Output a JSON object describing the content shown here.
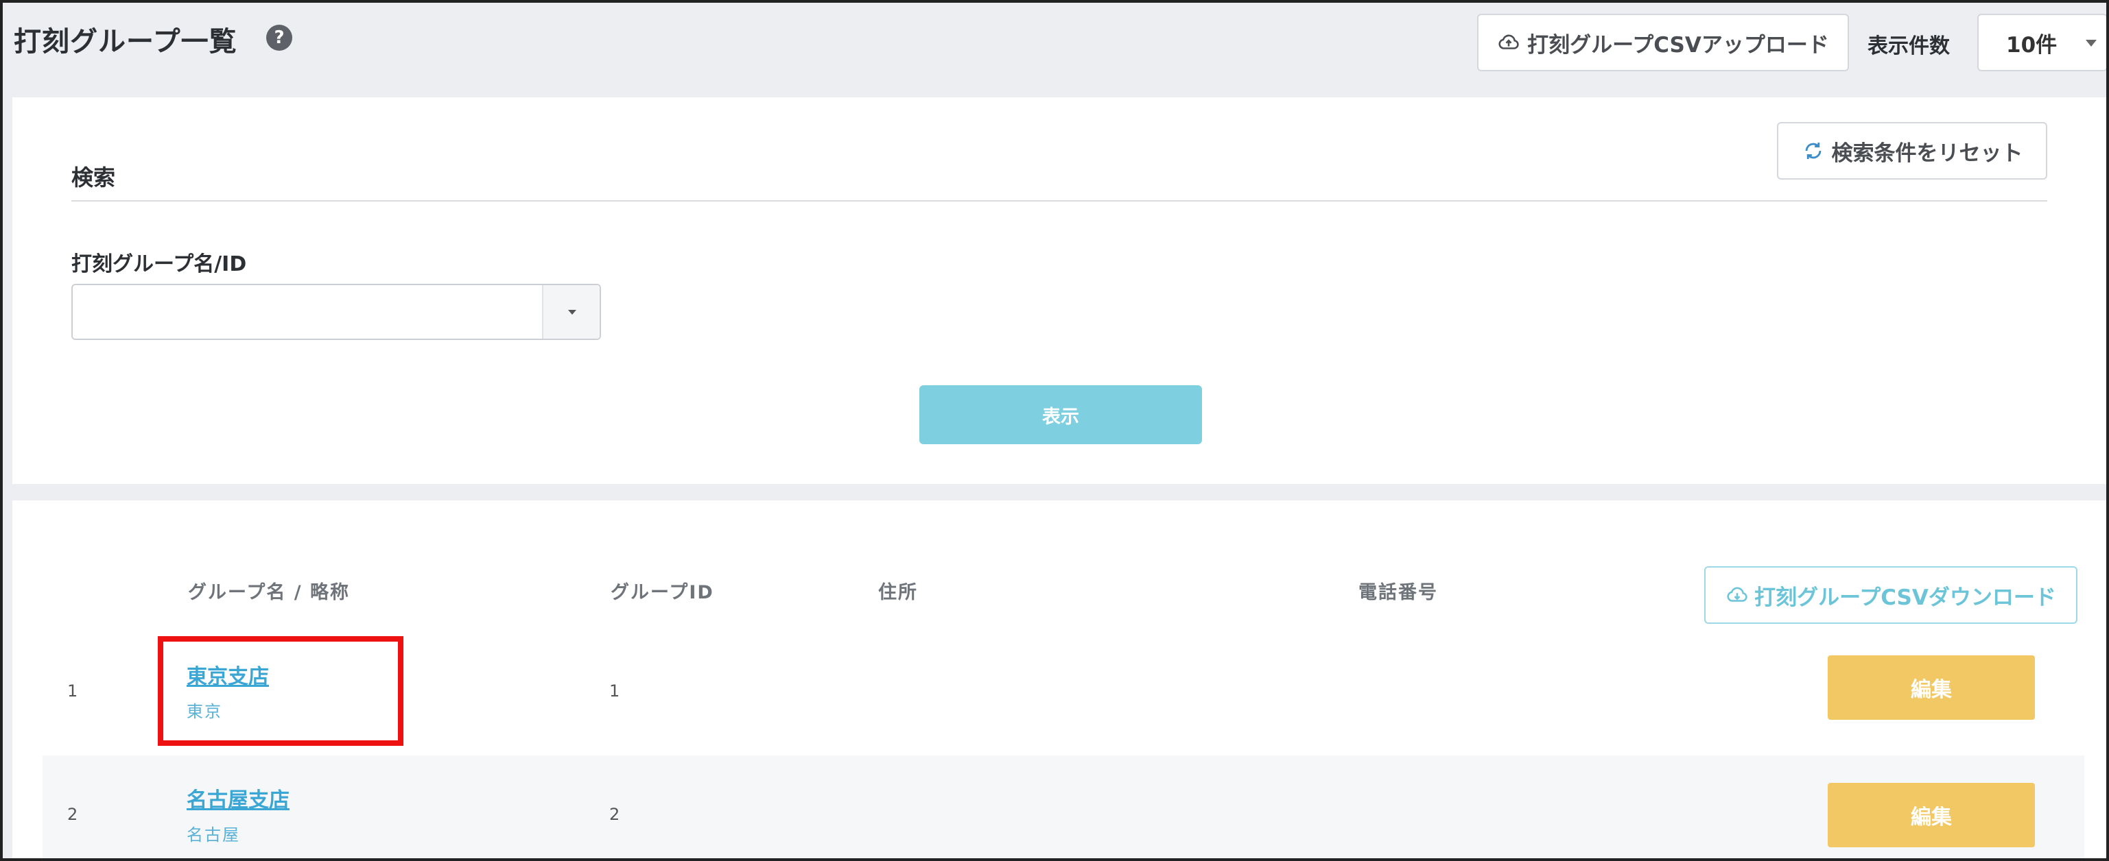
{
  "header": {
    "title": "打刻グループ一覧",
    "help_icon": "?",
    "upload_label": "打刻グループCSVアップロード",
    "count_label": "表示件数",
    "count_value": "10件"
  },
  "search": {
    "title": "検索",
    "reset_label": "検索条件をリセット",
    "field_label": "打刻グループ名/ID",
    "field_value": "",
    "submit_label": "表示"
  },
  "results": {
    "columns": {
      "name": "グループ名 / 略称",
      "id": "グループID",
      "address": "住所",
      "phone": "電話番号"
    },
    "download_label": "打刻グループCSVダウンロード",
    "rows": [
      {
        "no": "1",
        "name": "東京支店",
        "abbr": "東京",
        "id": "1",
        "address": "",
        "phone": "",
        "edit": "編集"
      },
      {
        "no": "2",
        "name": "名古屋支店",
        "abbr": "名古屋",
        "id": "2",
        "address": "",
        "phone": "",
        "edit": "編集"
      }
    ]
  },
  "colors": {
    "accent": "#7ecfe0",
    "link": "#3aa6d3",
    "edit": "#f2c865",
    "highlight": "#ee1111"
  },
  "icons": {
    "upload": "cloud-upload-icon",
    "reset": "refresh-icon",
    "download": "cloud-download-icon"
  }
}
